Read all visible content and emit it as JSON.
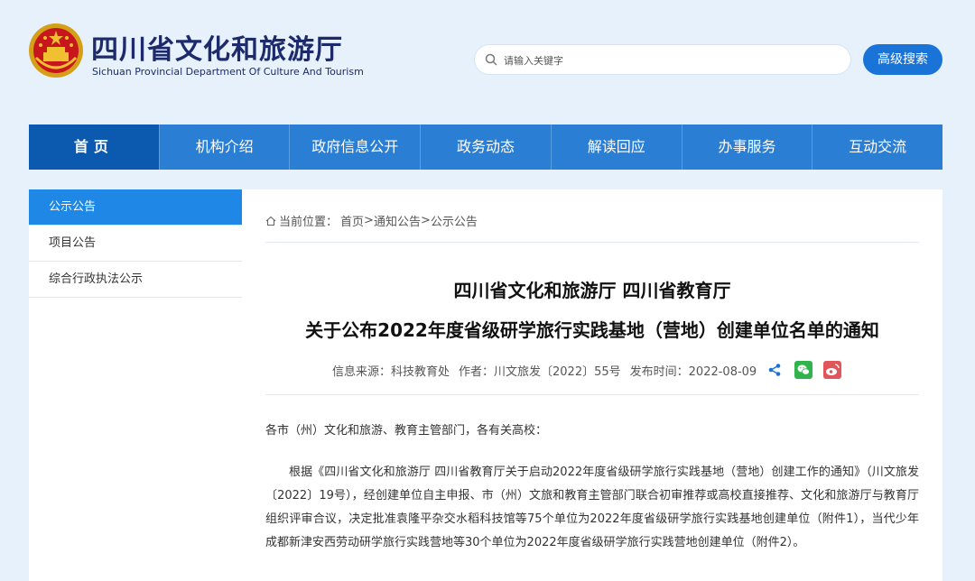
{
  "header": {
    "site_title": "四川省文化和旅游厅",
    "site_subtitle": "Sichuan Provincial Department Of Culture And Tourism",
    "search_placeholder": "请输入关键字",
    "advanced_search_label": "高级搜索"
  },
  "nav": {
    "items": [
      "首页",
      "机构介绍",
      "政府信息公开",
      "政务动态",
      "解读回应",
      "办事服务",
      "互动交流"
    ]
  },
  "sidebar": {
    "items": [
      "公示公告",
      "项目公告",
      "综合行政执法公示"
    ]
  },
  "breadcrumb": {
    "prefix": "当前位置：",
    "path": [
      "首页",
      "通知公告",
      "公示公告"
    ],
    "separator": ">"
  },
  "article": {
    "title_line1": "四川省文化和旅游厅 四川省教育厅",
    "title_line2": "关于公布2022年度省级研学旅行实践基地（营地）创建单位名单的通知",
    "source": "信息来源：科技教育处",
    "author": "作者：川文旅发〔2022〕55号",
    "publish_time": "发布时间：2022-08-09",
    "salutation": "各市（州）文化和旅游、教育主管部门，各有关高校：",
    "paragraph1": "根据《四川省文化和旅游厅 四川省教育厅关于启动2022年度省级研学旅行实践基地（营地）创建工作的通知》（川文旅发〔2022〕19号），经创建单位自主申报、市（州）文旅和教育主管部门联合初审推荐或高校直接推荐、文化和旅游厅与教育厅组织评审合议，决定批准袁隆平杂交水稻科技馆等75个单位为2022年度省级研学旅行实践基地创建单位（附件1），当代少年成都新津安西劳动研学旅行实践营地等30个单位为2022年度省级研学旅行实践营地创建单位（附件2）。"
  },
  "colors": {
    "nav_bg": "#2a7fd5",
    "nav_active": "#0c59b0",
    "accent": "#1a73d6",
    "page_bg": "#e6f1fb"
  }
}
